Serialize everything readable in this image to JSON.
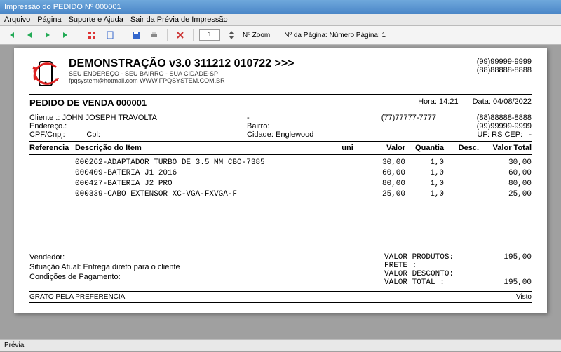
{
  "window": {
    "title": "Impressão do PEDIDO Nº 000001"
  },
  "menu": {
    "arquivo": "Arquivo",
    "pagina": "Página",
    "suporte": "Suporte e Ajuda",
    "sair": "Sair da Prévia de Impressão"
  },
  "toolbar": {
    "zoom_value": "1",
    "zoom_label": "Nº Zoom",
    "page_label": "Nº da Página: Número Página: 1"
  },
  "company": {
    "title": "DEMONSTRAÇÃO v3.0 311212 010722 >>>",
    "subtitle": "SEU ENDEREÇO - SEU BAIRRO - SUA CIDADE-SP",
    "contact": "fpqsystem@hotmail.com  WWW.FPQSYSTEM.COM.BR",
    "phone1": "(99)99999-9999",
    "phone2": "(88)88888-8888"
  },
  "order": {
    "title": "PEDIDO DE VENDA 000001",
    "time_label": "Hora:",
    "time": "14:21",
    "date_label": "Data:",
    "date": "04/08/2022"
  },
  "client": {
    "label_cliente": "Cliente   .:",
    "name": "JOHN JOSEPH TRAVOLTA",
    "dash": "-",
    "phone1": "(77)77777-7777",
    "phone_alt1": "(88)88888-8888",
    "label_endereco": "Endereço.:",
    "label_bairro": "Bairro:",
    "phone_alt2": "(99)99999-9999",
    "label_cpf": "CPF/Cnpj:",
    "label_cpl": "Cpl:",
    "label_cidade": "Cidade:",
    "cidade": "Englewood",
    "label_uf": "UF:",
    "uf": "RS",
    "label_cep": "CEP:",
    "cep": "-"
  },
  "columns": {
    "ref": "Referencia",
    "desc": "Descrição do Item",
    "uni": "uni",
    "valor": "Valor",
    "quantia": "Quantia",
    "desc2": "Desc.",
    "total": "Valor Total"
  },
  "items": [
    {
      "ref": "000262",
      "desc": "ADAPTADOR TURBO DE 3.5 MM CBO-7385",
      "valor": "30,00",
      "qty": "1,0",
      "disc": "",
      "total": "30,00"
    },
    {
      "ref": "000409",
      "desc": "BATERIA J1 2016",
      "valor": "60,00",
      "qty": "1,0",
      "disc": "",
      "total": "60,00"
    },
    {
      "ref": "000427",
      "desc": "BATERIA J2 PRO",
      "valor": "80,00",
      "qty": "1,0",
      "disc": "",
      "total": "80,00"
    },
    {
      "ref": "000339",
      "desc": "CABO EXTENSOR XC-VGA-FXVGA-F",
      "valor": "25,00",
      "qty": "1,0",
      "disc": "",
      "total": "25,00"
    }
  ],
  "footer": {
    "vendedor": "Vendedor:",
    "situacao_label": "Situação Atual:",
    "situacao": "Entrega direto para o cliente",
    "condicoes": "Condições de Pagamento:"
  },
  "totals": {
    "produtos_label": "VALOR PRODUTOS:",
    "produtos": "195,00",
    "frete_label": "FRETE         :",
    "frete": "",
    "desconto_label": "VALOR DESCONTO:",
    "desconto": "",
    "total_label": "VALOR TOTAL   :",
    "total": "195,00"
  },
  "thanks": "GRATO PELA PREFERENCIA",
  "visto": "Visto",
  "statusbar": "Prévia"
}
